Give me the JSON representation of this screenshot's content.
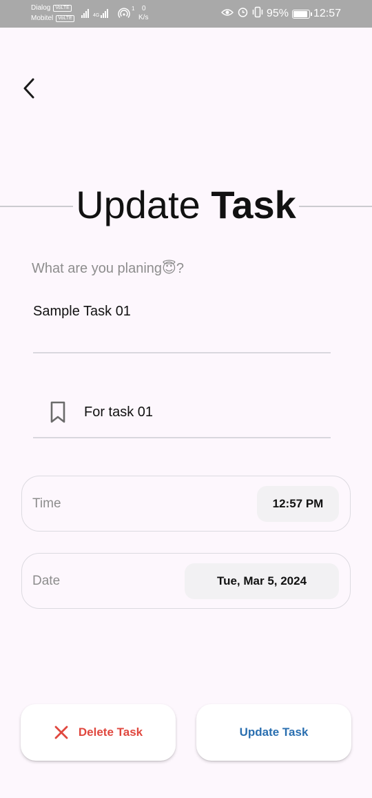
{
  "status_bar": {
    "carrier1": "Dialog",
    "carrier2": "Mobitel",
    "volte": "VoLTE",
    "net_type": "4G",
    "speed_value": "0",
    "speed_unit": "K/s",
    "speed_sup": "1",
    "battery": "95%",
    "time": "12:57"
  },
  "page": {
    "title_light": "Update",
    "title_bold": "Task",
    "prompt": "What are you planing",
    "prompt_emoji": "😇",
    "prompt_suffix": "?",
    "task_name": "Sample Task 01",
    "note": "For task 01"
  },
  "time_picker": {
    "label": "Time",
    "value": "12:57 PM"
  },
  "date_picker": {
    "label": "Date",
    "value": "Tue, Mar 5, 2024"
  },
  "actions": {
    "delete_label": "Delete Task",
    "update_label": "Update Task"
  },
  "colors": {
    "delete": "#e0473e",
    "update": "#2a6fb0",
    "status_bar": "#a9a9a9"
  }
}
